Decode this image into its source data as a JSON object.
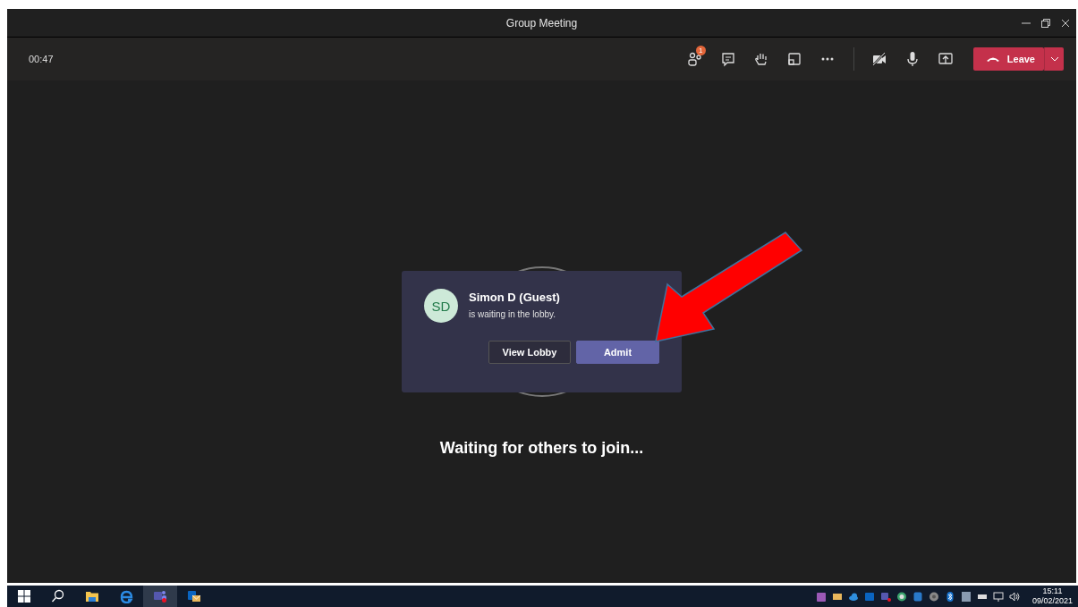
{
  "window": {
    "title": "Group Meeting"
  },
  "toolbar": {
    "timer": "00:47",
    "participants_badge": "1",
    "leave_label": "Leave"
  },
  "lobby_notification": {
    "initials": "SD",
    "name": "Simon D (Guest)",
    "message": "is waiting in the lobby.",
    "buttons": [
      {
        "label": "View Lobby",
        "kind": "secondary"
      },
      {
        "label": "Admit",
        "kind": "primary"
      }
    ]
  },
  "stage": {
    "status": "Waiting for others to join..."
  },
  "taskbar": {
    "apps": [
      {
        "kind": "search",
        "selected": false
      },
      {
        "kind": "explorer",
        "selected": false
      },
      {
        "kind": "browser",
        "selected": false
      },
      {
        "kind": "teams",
        "selected": true
      },
      {
        "kind": "mail",
        "selected": false
      }
    ],
    "time": "15:11",
    "date": "09/02/2021"
  }
}
